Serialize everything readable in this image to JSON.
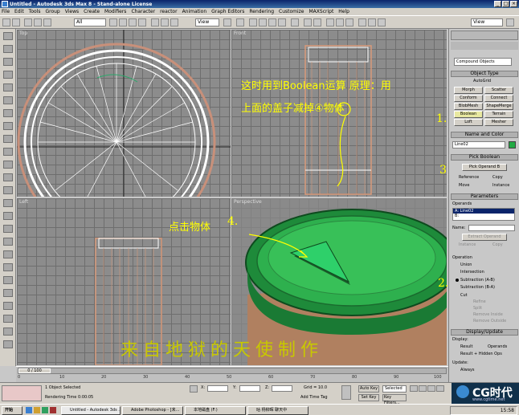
{
  "titlebar": {
    "title": "Untitled - Autodesk 3ds Max 8  - Stand-alone License"
  },
  "menu": [
    "File",
    "Edit",
    "Tools",
    "Group",
    "Views",
    "Create",
    "Modifiers",
    "Character",
    "reactor",
    "Animation",
    "Graph Editors",
    "Rendering",
    "Customize",
    "MAXScript",
    "Help"
  ],
  "toolbar": {
    "selection_filter": "All",
    "ref_coord": "View",
    "named_sel": "View"
  },
  "viewports": {
    "top": "Top",
    "front": "Front",
    "left": "Left",
    "perspective": "Perspective"
  },
  "annotations": {
    "line1": "这时用到Boolean运算 原理：用",
    "line2": "上面的盖子减掉④物体",
    "click_obj": "点击物体",
    "num1": "1.",
    "num2": "2.",
    "num3": "3",
    "num4": "4.",
    "watermark": "来自地狱的天使制作"
  },
  "cmd_panel": {
    "category": "Compound Objects",
    "object_type_title": "Object Type",
    "autogrid": "AutoGrid",
    "buttons": [
      "Morph",
      "Scatter",
      "Conform",
      "Connect",
      "BlobMesh",
      "ShapeMerge",
      "Boolean",
      "Terrain",
      "Loft",
      "Mesher"
    ],
    "name_color_title": "Name and Color",
    "object_name": "Line02",
    "pick_boolean_title": "Pick Boolean",
    "pick_operand": "Pick Operand B",
    "reference": "Reference",
    "copy": "Copy",
    "move": "Move",
    "instance": "Instance",
    "parameters_title": "Parameters",
    "operands_label": "Operands",
    "operand_a": "A: Line02",
    "operand_b": "B:",
    "name_label": "Name:",
    "extract_operand": "Extract Operand",
    "instance2": "Instance",
    "copy2": "Copy",
    "operation_label": "Operation",
    "ops": [
      "Union",
      "Intersection",
      "Subtraction (A-B)",
      "Subtraction (B-A)"
    ],
    "cut": "Cut",
    "cut_opts": [
      "Refine",
      "Split",
      "Remove Inside",
      "Remove Outside"
    ],
    "display_update_title": "Display/Update",
    "display_label": "Display:",
    "result": "Result",
    "operands": "Operands",
    "result_hidden": "Result + Hidden Ops",
    "update_label": "Update:",
    "always": "Always"
  },
  "timeline": {
    "frame": "0 / 100",
    "ticks": [
      "0",
      "10",
      "20",
      "30",
      "40",
      "50",
      "60",
      "70",
      "80",
      "90",
      "100"
    ]
  },
  "status": {
    "selected": "1 Object Selected",
    "render_time": "Rendering Time  0:00:05",
    "x_label": "X:",
    "y_label": "Y:",
    "z_label": "Z:",
    "grid": "Grid = 10.0",
    "add_time_tag": "Add Time Tag",
    "auto_key": "Auto Key",
    "set_key": "Set Key",
    "selected_dd": "Selected",
    "key_filters": "Key Filters..."
  },
  "taskbar": {
    "start": "开始",
    "tasks": [
      "Untitled - Autodesk 3ds ...",
      "Adobe Photoshop - [未...",
      "本地磁盘 (F:)",
      "咕 杨柳晖 聊天中"
    ],
    "clock": "15:58"
  },
  "logo": {
    "text": "CG时代",
    "url": "www.cgtime.net"
  },
  "colors": {
    "accent": "#ffff00",
    "green": "#22aa44",
    "panel_bg": "#c8c8c8",
    "title_blue": "#0a246a"
  }
}
